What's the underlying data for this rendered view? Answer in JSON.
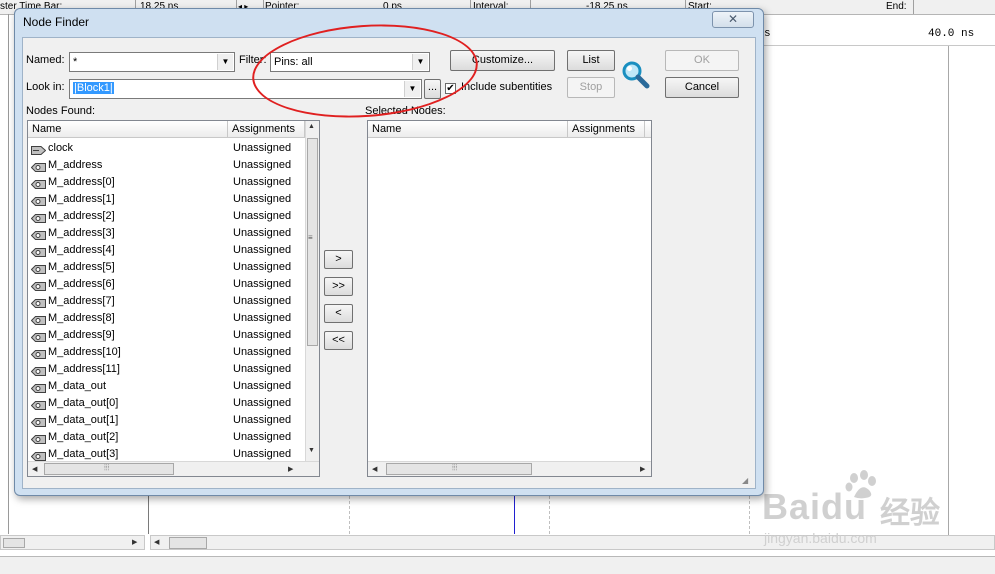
{
  "background": {
    "toolbar": {
      "master_time_bar_label": "ster Time Bar:",
      "master_time_value": "18.25 ns",
      "pointer_label": "Pointer:",
      "pointer_value": "0 ps",
      "interval_label": "Interval:",
      "interval_value": "-18.25 ns",
      "start_label": "Start:",
      "end_label": "End:"
    },
    "ruler_label_1": "s",
    "ruler_label_2": "40.0 ns"
  },
  "dialog": {
    "title": "Node Finder",
    "close_glyph": "✕",
    "named_label": "Named:",
    "named_value": "*",
    "filter_label": "Filter:",
    "filter_value": "Pins: all",
    "customize_button": "Customize...",
    "list_button": "List",
    "stop_button": "Stop",
    "ok_button": "OK",
    "cancel_button": "Cancel",
    "look_in_label": "Look in:",
    "look_in_value": "|Block1|",
    "browse_button": "...",
    "include_subentities_label": "Include subentities",
    "include_subentities_checked": true,
    "nodes_found_label": "Nodes Found:",
    "selected_nodes_label": "Selected Nodes:",
    "columns": {
      "name": "Name",
      "assignments": "Assignments"
    },
    "nodes_found": [
      {
        "name": "clock",
        "assignment": "Unassigned",
        "kind": "input"
      },
      {
        "name": "M_address",
        "assignment": "Unassigned",
        "kind": "output"
      },
      {
        "name": "M_address[0]",
        "assignment": "Unassigned",
        "kind": "output"
      },
      {
        "name": "M_address[1]",
        "assignment": "Unassigned",
        "kind": "output"
      },
      {
        "name": "M_address[2]",
        "assignment": "Unassigned",
        "kind": "output"
      },
      {
        "name": "M_address[3]",
        "assignment": "Unassigned",
        "kind": "output"
      },
      {
        "name": "M_address[4]",
        "assignment": "Unassigned",
        "kind": "output"
      },
      {
        "name": "M_address[5]",
        "assignment": "Unassigned",
        "kind": "output"
      },
      {
        "name": "M_address[6]",
        "assignment": "Unassigned",
        "kind": "output"
      },
      {
        "name": "M_address[7]",
        "assignment": "Unassigned",
        "kind": "output"
      },
      {
        "name": "M_address[8]",
        "assignment": "Unassigned",
        "kind": "output"
      },
      {
        "name": "M_address[9]",
        "assignment": "Unassigned",
        "kind": "output"
      },
      {
        "name": "M_address[10]",
        "assignment": "Unassigned",
        "kind": "output"
      },
      {
        "name": "M_address[11]",
        "assignment": "Unassigned",
        "kind": "output"
      },
      {
        "name": "M_data_out",
        "assignment": "Unassigned",
        "kind": "output"
      },
      {
        "name": "M_data_out[0]",
        "assignment": "Unassigned",
        "kind": "output"
      },
      {
        "name": "M_data_out[1]",
        "assignment": "Unassigned",
        "kind": "output"
      },
      {
        "name": "M_data_out[2]",
        "assignment": "Unassigned",
        "kind": "output"
      },
      {
        "name": "M_data_out[3]",
        "assignment": "Unassigned",
        "kind": "output"
      }
    ],
    "transfer_buttons": [
      ">",
      ">>",
      "<",
      "<<"
    ]
  },
  "watermark": {
    "brand": "Baidu",
    "brand_cn": "经验",
    "url": "jingyan.baidu.com"
  },
  "colors": {
    "annotation": "#e02020",
    "selection": "#3399ff",
    "dialog_frame": "#cfe0f1"
  }
}
